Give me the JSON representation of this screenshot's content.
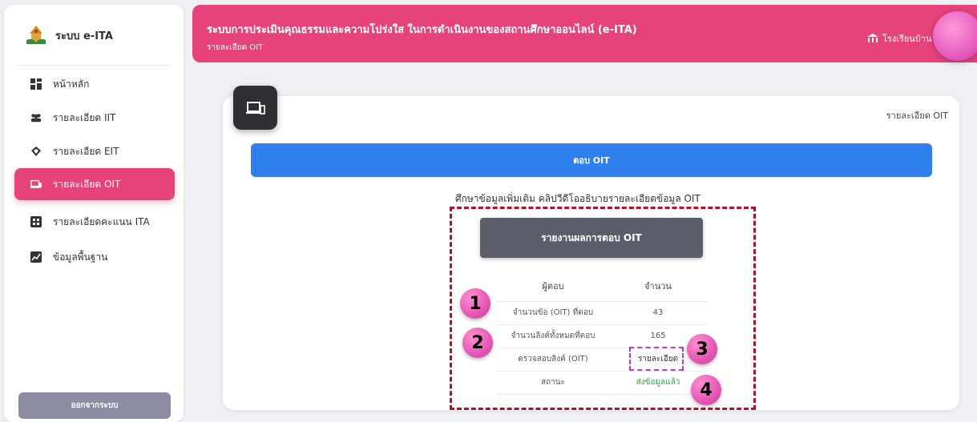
{
  "sidebar": {
    "brand": "ระบบ e-ITA",
    "items": [
      {
        "label": "หน้าหลัก",
        "icon": "dashboard-icon"
      },
      {
        "label": "รายละเอียด IIT",
        "icon": "users-icon"
      },
      {
        "label": "รายละเอียด EIT",
        "icon": "gem-icon"
      },
      {
        "label": "รายละเอียด OIT",
        "icon": "devices-icon",
        "active": true
      },
      {
        "label": "รายละเอียดคะแนน ITA",
        "icon": "grid-icon"
      },
      {
        "label": "ข้อมูลพื้นฐาน",
        "icon": "chart-icon"
      }
    ],
    "logout": "ออกจากระบบ"
  },
  "header": {
    "title": "ระบบการประเมินคุณธรรมและความโปร่งใส ในการดำเนินงานของสถานศึกษาออนไลน์ (e-ITA)",
    "subtitle": "รายละเอียด OIT",
    "school": "โรงเรียนบ้าน"
  },
  "main": {
    "card_label": "รายละเอียด OIT",
    "answer_button": "ตอบ OIT",
    "info_link": "ศึกษาข้อมูลเพิ่มเติม คลิปวีดีโออธิบายรายละเอียดข้อมูล OIT",
    "report_button": "รายงานผลการตอบ OIT",
    "table": {
      "headers": [
        "ผู้ตอบ",
        "จำนวน"
      ],
      "rows": [
        [
          "จำนวนข้อ (OIT) ที่ตอบ",
          "43"
        ],
        [
          "จำนวนลิงค์ทั้งหมดที่ตอบ",
          "165"
        ],
        [
          "ตรวจสอบลิงค์ (OIT)",
          "รายละเอียด"
        ],
        [
          "สถานะ",
          "ส่งข้อมูลแล้ว"
        ]
      ]
    }
  },
  "annotations": [
    "1",
    "2",
    "3",
    "4"
  ],
  "colors": {
    "accent": "#e6437a",
    "primary": "#2f80ed",
    "dark": "#2f3033",
    "status_ok": "#3aa04a"
  }
}
